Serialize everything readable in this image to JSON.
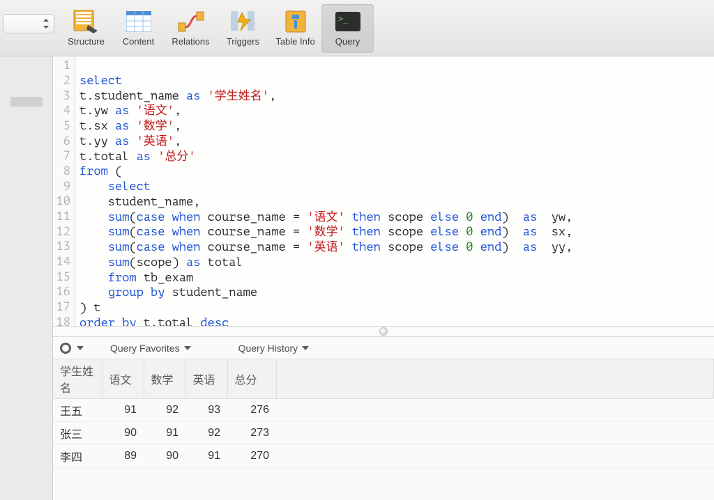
{
  "toolbar": {
    "tabs": [
      {
        "label": "Structure"
      },
      {
        "label": "Content"
      },
      {
        "label": "Relations"
      },
      {
        "label": "Triggers"
      },
      {
        "label": "Table Info"
      },
      {
        "label": "Query"
      }
    ]
  },
  "editor": {
    "lines": [
      "",
      "select",
      "t.student_name as '学生姓名',",
      "t.yw as '语文',",
      "t.sx as '数学',",
      "t.yy as '英语',",
      "t.total as '总分'",
      "from (",
      "    select",
      "    student_name,",
      "    sum(case when course_name = '语文' then scope else 0 end)  as  yw,",
      "    sum(case when course_name = '数学' then scope else 0 end)  as  sx,",
      "    sum(case when course_name = '英语' then scope else 0 end)  as  yy,",
      "    sum(scope) as total",
      "    from tb_exam",
      "    group by student_name",
      ") t",
      "order by t.total desc"
    ],
    "line_numbers": [
      "1",
      "2",
      "3",
      "4",
      "5",
      "6",
      "7",
      "8",
      "9",
      "10",
      "11",
      "12",
      "13",
      "14",
      "15",
      "16",
      "17",
      "18"
    ]
  },
  "results": {
    "favorites_label": "Query Favorites",
    "history_label": "Query History",
    "columns": [
      "学生姓名",
      "语文",
      "数学",
      "英语",
      "总分"
    ],
    "rows": [
      {
        "name": "王五",
        "c1": 91,
        "c2": 92,
        "c3": 93,
        "c4": 276
      },
      {
        "name": "张三",
        "c1": 90,
        "c2": 91,
        "c3": 92,
        "c4": 273
      },
      {
        "name": "李四",
        "c1": 89,
        "c2": 90,
        "c3": 91,
        "c4": 270
      }
    ]
  },
  "chart_data": {
    "type": "table",
    "columns": [
      "学生姓名",
      "语文",
      "数学",
      "英语",
      "总分"
    ],
    "rows": [
      [
        "王五",
        91,
        92,
        93,
        276
      ],
      [
        "张三",
        90,
        91,
        92,
        273
      ],
      [
        "李四",
        89,
        90,
        91,
        270
      ]
    ]
  }
}
